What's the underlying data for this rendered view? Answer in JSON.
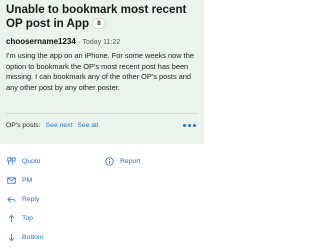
{
  "post": {
    "title": "Unable to bookmark most recent OP post in App",
    "badge": "8",
    "author": "choosername1234",
    "separator": "·",
    "time": "Today 11:22",
    "body": "I'm using the app on an iPhone. For some weeks now the option to bookmark the OP's most recent post has been missing. I can bookmark any of the other OP's posts and any other post by any other poster."
  },
  "op_bar": {
    "label": "OP's posts:",
    "see_next": "See next",
    "see_all": "See all",
    "more_icon": "more-dots-icon"
  },
  "actions": [
    {
      "label": "Quote",
      "icon": "quote-icon"
    },
    {
      "label": "Report",
      "icon": "info-icon"
    },
    {
      "label": "PM",
      "icon": "mail-icon"
    },
    {
      "label": "Reply",
      "icon": "reply-icon"
    },
    {
      "label": "Top",
      "icon": "arrow-up-icon"
    },
    {
      "label": "Bottom",
      "icon": "arrow-down-icon"
    }
  ],
  "colors": {
    "accent": "#2a6fc9",
    "post_bg": "#eaf4ec"
  }
}
